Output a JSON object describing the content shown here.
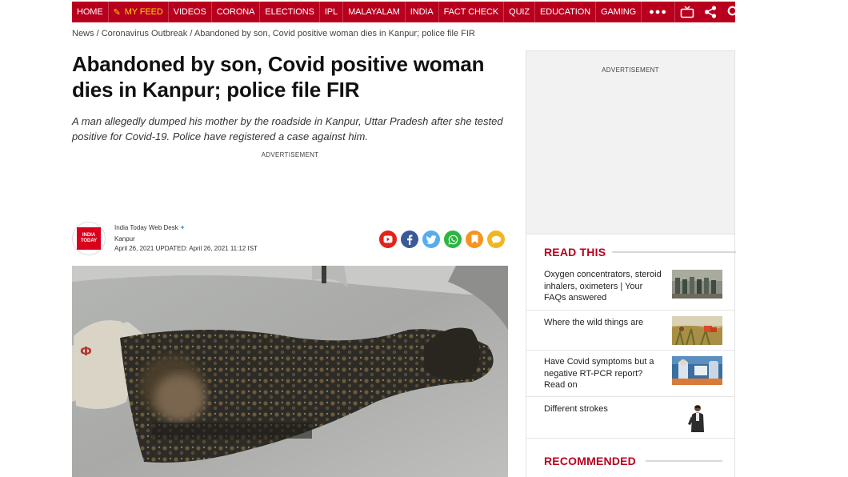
{
  "nav": {
    "items": [
      "HOME",
      "MY FEED",
      "VIDEOS",
      "CORONA",
      "ELECTIONS",
      "IPL",
      "MALAYALAM",
      "INDIA",
      "FACT CHECK",
      "QUIZ",
      "EDUCATION",
      "GAMING"
    ],
    "more_label": "●●●",
    "icons": [
      "tv-icon",
      "share-icon",
      "search-icon",
      "user-icon"
    ]
  },
  "breadcrumb": {
    "items": [
      "News",
      "Coronavirus Outbreak",
      "Abandoned by son, Covid positive woman dies in Kanpur; police file FIR"
    ],
    "separator": " / "
  },
  "article": {
    "headline": "Abandoned by son, Covid positive woman dies in Kanpur; police file FIR",
    "summary": "A man allegedly dumped his mother by the roadside in Kanpur, Uttar Pradesh after she tested positive for Covid-19. Police have registered a case against him.",
    "ad_label": "ADVERTISEMENT",
    "author": "India Today Web Desk",
    "location": "Kanpur",
    "dates": "April 26, 2021  UPDATED: April 26, 2021 11:12 IST",
    "logo_text": [
      "INDIA",
      "TODAY"
    ],
    "share_icons": [
      "youtube-icon",
      "facebook-icon",
      "twitter-icon",
      "whatsapp-icon",
      "bookmark-icon",
      "comment-icon"
    ]
  },
  "sidebar": {
    "ad_label": "ADVERTISEMENT",
    "read_this_title": "READ THIS",
    "recommended_title": "RECOMMENDED",
    "stories": [
      {
        "title": "Oxygen concentrators, steroid inhalers, oximeters | Your FAQs answered"
      },
      {
        "title": "Where the wild things are"
      },
      {
        "title": "Have Covid symptoms but a negative RT-PCR report? Read on"
      },
      {
        "title": "Different strokes"
      }
    ]
  },
  "colors": {
    "brand_red": "#b8001e",
    "feed_yellow": "#ffd400"
  }
}
